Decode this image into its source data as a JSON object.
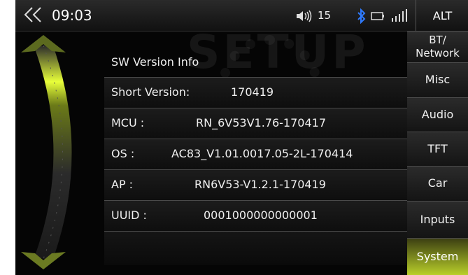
{
  "statusbar": {
    "time": "09:03",
    "volume": "15",
    "alt_label": "ALT"
  },
  "background": {
    "watermark": "SETUP"
  },
  "panel": {
    "title": "SW Version Info",
    "rows": [
      {
        "label": "Short Version:",
        "value": "170419"
      },
      {
        "label": "MCU :",
        "value": "RN_6V53V1.76-170417"
      },
      {
        "label": "OS :",
        "value": "AC83_V1.01.0017.05-2L-170414"
      },
      {
        "label": "AP :",
        "value": "RN6V53-V1.2.1-170419"
      },
      {
        "label": "UUID :",
        "value": "0001000000000001"
      }
    ]
  },
  "sidenav": {
    "items": [
      {
        "label": "BT/ Network",
        "line1": "BT/",
        "line2": "Network"
      },
      {
        "label": "Misc"
      },
      {
        "label": "Audio"
      },
      {
        "label": "TFT"
      },
      {
        "label": "Car"
      },
      {
        "label": "Inputs"
      },
      {
        "label": "System",
        "active": true
      }
    ]
  },
  "colors": {
    "accent": "#b9cf2a",
    "background": "#050505",
    "text": "#f0f0f0"
  },
  "icons": [
    "back-icon",
    "volume-icon",
    "bluetooth-icon",
    "battery-icon",
    "signal-icon"
  ]
}
